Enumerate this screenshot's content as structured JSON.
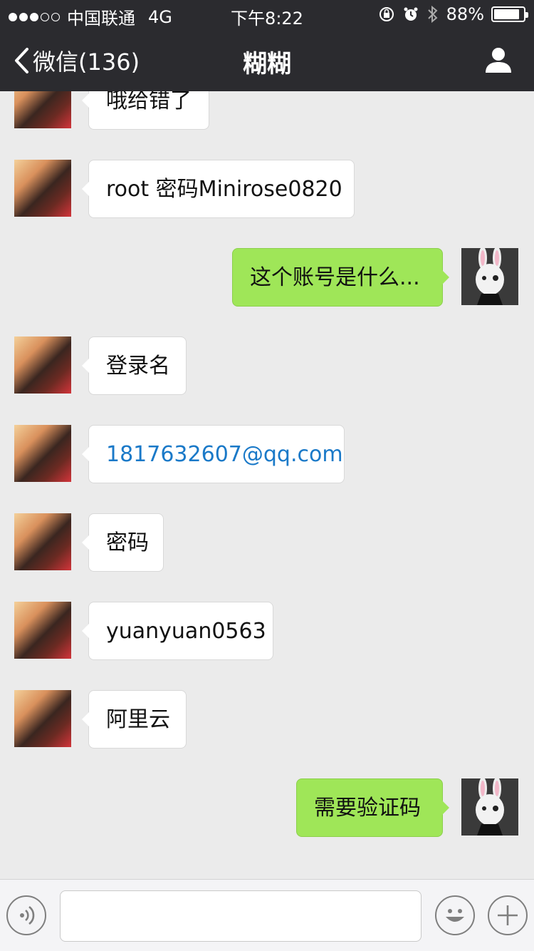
{
  "status_bar": {
    "carrier": "中国联通",
    "network": "4G",
    "time": "下午8:22",
    "battery_pct": "88%",
    "battery_level": 0.88
  },
  "nav": {
    "back_label": "微信(136)",
    "title": "糊糊"
  },
  "messages": [
    {
      "text": "哦给错了"
    },
    {
      "text": "root 密码Minirose0820"
    },
    {
      "text": "这个账号是什么..."
    },
    {
      "text": "登录名"
    },
    {
      "text": "1817632607@qq.com"
    },
    {
      "text": "密码"
    },
    {
      "text": "yuanyuan0563"
    },
    {
      "text": "阿里云"
    },
    {
      "text": "需要验证码"
    }
  ],
  "colors": {
    "bar_bg": "#2b2b2f",
    "chat_bg": "#ebebeb",
    "outgoing_bubble": "#9fe658",
    "link_text": "#1a79c8"
  },
  "icons": [
    "back-chevron-icon",
    "profile-icon",
    "voice-icon",
    "emoji-icon",
    "plus-icon",
    "lock-rotation-icon",
    "alarm-icon",
    "bluetooth-icon"
  ]
}
